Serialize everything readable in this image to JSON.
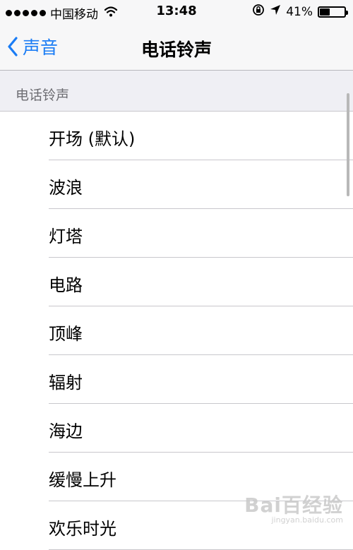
{
  "status_bar": {
    "carrier": "中国移动",
    "time": "13:48",
    "battery_percent": "41%",
    "battery_level": 0.41,
    "icons": [
      "signal-dots-icon",
      "wifi-icon",
      "rotation-lock-icon",
      "location-arrow-icon",
      "battery-icon"
    ]
  },
  "nav": {
    "back_label": "声音",
    "title": "电话铃声"
  },
  "section": {
    "header": "电话铃声"
  },
  "ringtones": [
    {
      "label": "开场 (默认)"
    },
    {
      "label": "波浪"
    },
    {
      "label": "灯塔"
    },
    {
      "label": "电路"
    },
    {
      "label": "顶峰"
    },
    {
      "label": "辐射"
    },
    {
      "label": "海边"
    },
    {
      "label": "缓慢上升"
    },
    {
      "label": "欢乐时光"
    }
  ],
  "watermark": {
    "logo": "Bai百经验",
    "url": "jingyan.baidu.com"
  },
  "colors": {
    "accent": "#1a7cf5",
    "nav_background": "#f7f7f8",
    "section_background": "#efeff4"
  }
}
